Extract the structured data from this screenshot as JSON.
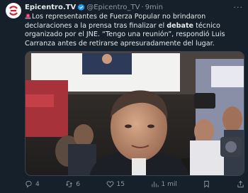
{
  "tweet": {
    "author_name": "Epicentro.TV",
    "handle": "@Epicentro_TV",
    "separator": "·",
    "time": "9min",
    "more": "···",
    "text_part1": "Los representantes de Fuerza Popular no brindaron declaraciones a la prensa tras finalizar el ",
    "text_bold": "debate",
    "text_part2": " técnico organizado por el JNE. “Tengo una reunión”, respondió Luis Carranza antes de retirarse apresuradamente del lugar."
  },
  "actions": {
    "replies": "4",
    "retweets": "6",
    "likes": "15",
    "views": "1 mil"
  },
  "colors": {
    "background": "#15202b",
    "brand_red": "#d6202a",
    "verified_blue": "#1d9bf0",
    "muted": "#8b98a5"
  },
  "icons": [
    "siren-icon",
    "verified-badge-icon",
    "reply-icon",
    "retweet-icon",
    "like-icon",
    "views-icon",
    "bookmark-icon",
    "share-icon"
  ]
}
